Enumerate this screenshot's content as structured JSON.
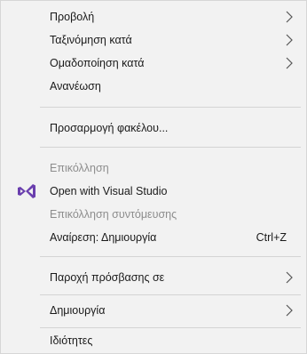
{
  "menu": {
    "items": [
      {
        "label": "Προβολή",
        "submenu": true
      },
      {
        "label": "Ταξινόμηση κατά",
        "submenu": true
      },
      {
        "label": "Ομαδοποίηση κατά",
        "submenu": true
      },
      {
        "label": "Ανανέωση"
      },
      {
        "label": "Προσαρμογή φακέλου..."
      },
      {
        "label": "Επικόλληση",
        "disabled": true
      },
      {
        "label": "Open with Visual Studio",
        "icon": "visual-studio-icon"
      },
      {
        "label": "Επικόλληση συντόμευσης",
        "disabled": true
      },
      {
        "label": "Αναίρεση: Δημιουργία",
        "shortcut": "Ctrl+Z"
      },
      {
        "label": "Παροχή πρόσβασης σε",
        "submenu": true
      },
      {
        "label": "Δημιουργία",
        "submenu": true
      },
      {
        "label": "Ιδιότητες"
      }
    ]
  },
  "colors": {
    "menu_background": "#f2f2f2",
    "disabled_text": "#8d8d8d",
    "visual_studio_purple": "#6a3fae"
  }
}
